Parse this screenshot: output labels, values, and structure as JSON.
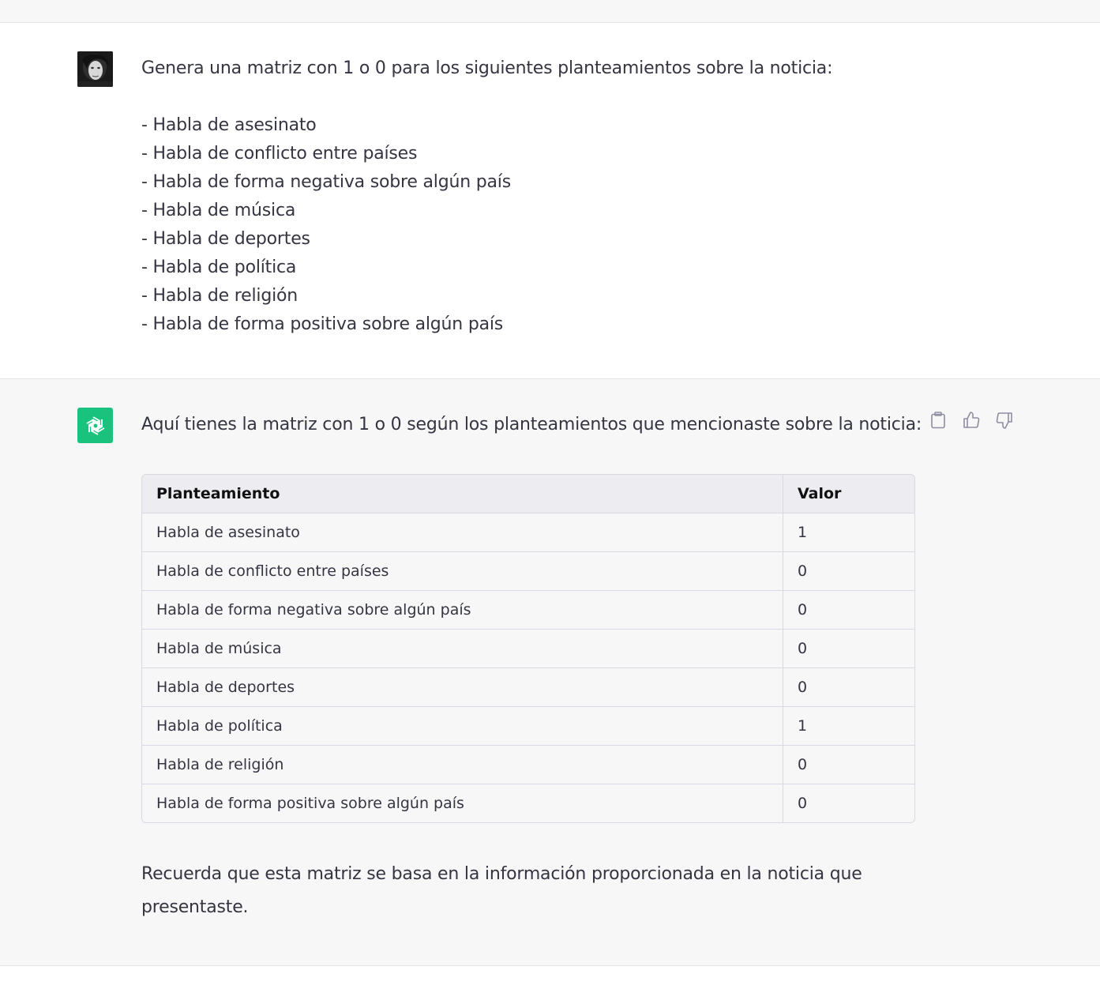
{
  "user_message": {
    "intro": "Genera una matriz con 1 o 0 para los siguientes planteamientos sobre la noticia:",
    "items": [
      "- Habla de asesinato",
      "- Habla de conflicto entre países",
      "- Habla de forma negativa sobre algún país",
      "- Habla de música",
      "- Habla de deportes",
      "- Habla de política",
      "- Habla de religión",
      "- Habla de forma positiva sobre algún país"
    ]
  },
  "assistant_message": {
    "intro": "Aquí tienes la matriz con 1 o 0 según los planteamientos que mencionaste sobre la noticia:",
    "table": {
      "headers": [
        "Planteamiento",
        "Valor"
      ],
      "rows": [
        [
          "Habla de asesinato",
          "1"
        ],
        [
          "Habla de conflicto entre países",
          "0"
        ],
        [
          "Habla de forma negativa sobre algún país",
          "0"
        ],
        [
          "Habla de música",
          "0"
        ],
        [
          "Habla de deportes",
          "0"
        ],
        [
          "Habla de política",
          "1"
        ],
        [
          "Habla de religión",
          "0"
        ],
        [
          "Habla de forma positiva sobre algún país",
          "0"
        ]
      ]
    },
    "outro": "Recuerda que esta matriz se basa en la información proporcionada en la noticia que presentaste."
  },
  "icons": {
    "copy": "clipboard-icon",
    "like": "thumbs-up-icon",
    "dislike": "thumbs-down-icon",
    "assistant_logo": "openai-logo-icon"
  },
  "colors": {
    "assistant_avatar": "#19c37d",
    "assistant_bg": "#f7f7f8",
    "text": "#343541"
  }
}
